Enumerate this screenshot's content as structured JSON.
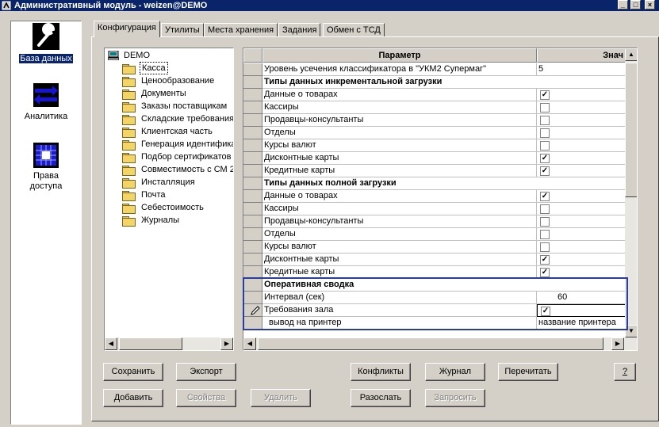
{
  "window": {
    "title": "Административный модуль - weizen@DEMO",
    "controls": [
      "_",
      "□",
      "×"
    ]
  },
  "sidebar": {
    "items": [
      {
        "label": "База данных",
        "icon": "wrench-icon",
        "selected": true
      },
      {
        "label": "Аналитика",
        "icon": "arrows-icon",
        "selected": false
      },
      {
        "label": "Права доступа",
        "icon": "permissions-icon",
        "selected": false
      }
    ]
  },
  "tabs": [
    {
      "label": "Конфигурация",
      "active": true
    },
    {
      "label": "Утилиты",
      "active": false
    },
    {
      "label": "Места хранения",
      "active": false
    },
    {
      "label": "Задания",
      "active": false
    },
    {
      "label": "Обмен с ТСД",
      "active": false
    }
  ],
  "tree": {
    "root": "DEMO",
    "selected": "Касса",
    "items": [
      "Касса",
      "Ценообразование",
      "Документы",
      "Заказы поставщикам",
      "Складские требования",
      "Клиентская часть",
      "Генерация идентифика",
      "Подбор сертификатов с",
      "Совместимость с СМ 2",
      "Инсталляция",
      "Почта",
      "Себестоимость",
      "Журналы"
    ]
  },
  "grid": {
    "columns": {
      "param": "Параметр",
      "value": "Знач"
    },
    "rows": [
      {
        "name": "Уровень усечения классификатора в \"УКМ2 Супермаг\"",
        "type": "text",
        "value": "5"
      },
      {
        "name": "Типы данных инкрементальной загрузки",
        "type": "section"
      },
      {
        "name": "Данные о товарах",
        "type": "check",
        "checked": true
      },
      {
        "name": "Кассиры",
        "type": "check",
        "checked": false
      },
      {
        "name": "Продавцы-консультанты",
        "type": "check",
        "checked": false
      },
      {
        "name": "Отделы",
        "type": "check",
        "checked": false
      },
      {
        "name": "Курсы валют",
        "type": "check",
        "checked": false
      },
      {
        "name": "Дисконтные карты",
        "type": "check",
        "checked": true
      },
      {
        "name": "Кредитные карты",
        "type": "check",
        "checked": true
      },
      {
        "name": "Типы данных полной загрузки",
        "type": "section"
      },
      {
        "name": "Данные о товарах",
        "type": "check",
        "checked": true
      },
      {
        "name": "Кассиры",
        "type": "check",
        "checked": false
      },
      {
        "name": "Продавцы-консультанты",
        "type": "check",
        "checked": false
      },
      {
        "name": "Отделы",
        "type": "check",
        "checked": false
      },
      {
        "name": "Курсы валют",
        "type": "check",
        "checked": false
      },
      {
        "name": "Дисконтные карты",
        "type": "check",
        "checked": true
      },
      {
        "name": "Кредитные карты",
        "type": "check",
        "checked": true
      },
      {
        "name": "Оперативная сводка",
        "type": "section"
      },
      {
        "name": "Интервал (сек)",
        "type": "text",
        "value": "60"
      },
      {
        "name": "Требования зала",
        "type": "check",
        "checked": true,
        "editing": true
      },
      {
        "name": "вывод на принтер",
        "type": "text",
        "value": "название принтера"
      }
    ]
  },
  "buttons": {
    "save": "Сохранить",
    "export": "Экспорт",
    "conflicts": "Конфликты",
    "journal": "Журнал",
    "reread": "Перечитать",
    "help": "?",
    "add": "Добавить",
    "properties": "Свойства",
    "delete": "Удалить",
    "send": "Разослать",
    "request": "Запросить"
  },
  "colors": {
    "selection": "#0a246a",
    "highlight_box": "#2b3ea0",
    "checkbox_mark": "#000000"
  }
}
